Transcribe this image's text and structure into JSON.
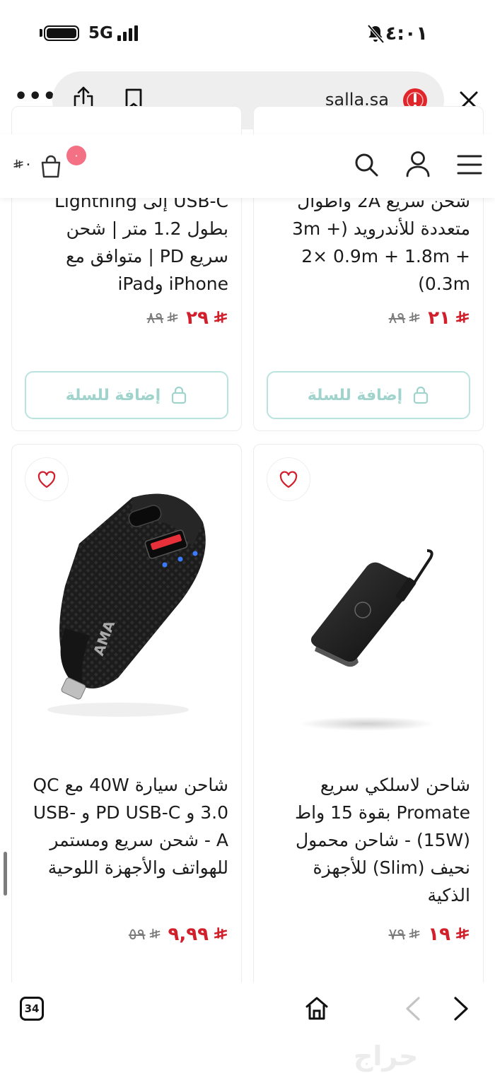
{
  "status_bar": {
    "time": "٤:٠١",
    "network": "5G"
  },
  "browser": {
    "url": "salla.sa",
    "tab_count": "34"
  },
  "header": {
    "cart_amount": "٠",
    "cart_badge": "٠"
  },
  "products": [
    {
      "position": "top-left",
      "title": "USB-C إلى Lightning بطول 1.2 متر | شحن سريع PD | متوافق مع iPhone وiPad",
      "price": "٢٩",
      "old_price": "٨٩",
      "add_label": "إضافة للسلة"
    },
    {
      "position": "top-right",
      "title": "شحن سريع 2A وأطوال متعددة للأندرويد (3m + 2× 0.9m + 1.8m + 0.3m)",
      "price": "٢١",
      "old_price": "٨٩",
      "add_label": "إضافة للسلة"
    },
    {
      "position": "bottom-left",
      "title": "شاحن سيارة 40W مع QC 3.0 و PD USB-C و USB-A - شحن سريع ومستمر للهواتف والأجهزة اللوحية",
      "price": "٩,٩٩",
      "old_price": "٥٩"
    },
    {
      "position": "bottom-right",
      "title": "شاحن لاسلكي سريع Promate بقوة 15 واط (15W) - شاحن محمول نحيف (Slim) للأجهزة الذكية",
      "price": "١٩",
      "old_price": "٧٩"
    }
  ],
  "watermark": "حراج",
  "colors": {
    "price_red": "#d11f2c",
    "button_teal": "#9fd3cc",
    "badge_pink": "#f47085"
  }
}
